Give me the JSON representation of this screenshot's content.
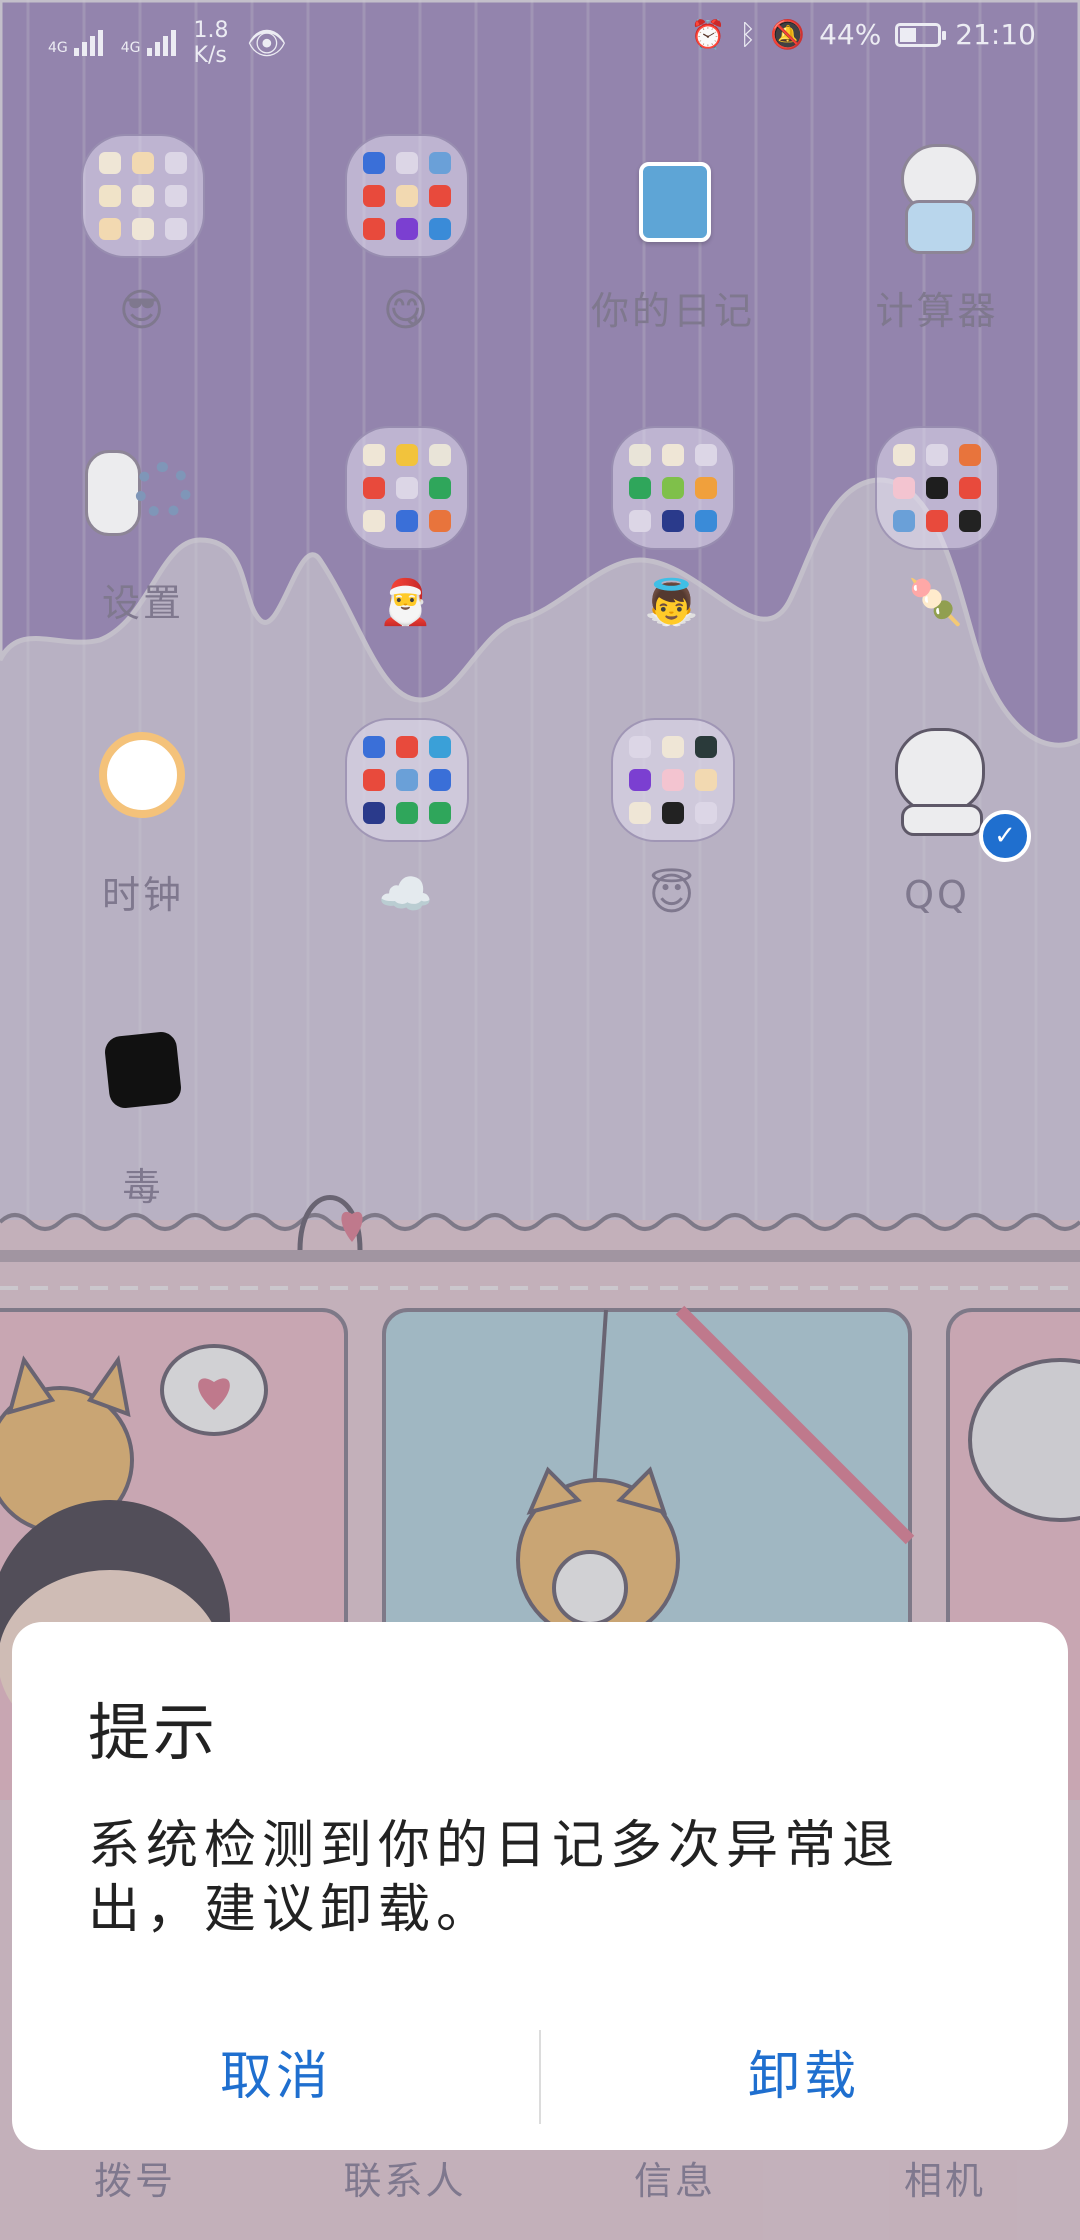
{
  "status_bar": {
    "network_1": "4G",
    "network_2": "4G",
    "speed_value": "1.8",
    "speed_unit": "K/s",
    "battery_percent": "44%",
    "time": "21:10"
  },
  "apps": [
    {
      "label": "",
      "emoji": "😎"
    },
    {
      "label": "",
      "emoji": "😋"
    },
    {
      "label": "你的日记"
    },
    {
      "label": "计算器"
    },
    {
      "label": "设置"
    },
    {
      "label": "",
      "emoji": "🎅"
    },
    {
      "label": "",
      "emoji": "👼"
    },
    {
      "label": "",
      "emoji": "🍡"
    },
    {
      "label": "时钟"
    },
    {
      "label": "",
      "emoji": "☁️"
    },
    {
      "label": "",
      "emoji": "😇"
    },
    {
      "label": "QQ"
    },
    {
      "label": "毒"
    }
  ],
  "dock": [
    "拨号",
    "联系人",
    "信息",
    "相机"
  ],
  "dialog": {
    "title": "提示",
    "message": "系统检测到你的日记多次异常退出，建议卸载。",
    "cancel": "取消",
    "confirm": "卸载"
  },
  "colors": {
    "accent": "#1f6fcf",
    "wallpaper_purple": "#a995c9",
    "wallpaper_pink": "#ecd2dc"
  }
}
